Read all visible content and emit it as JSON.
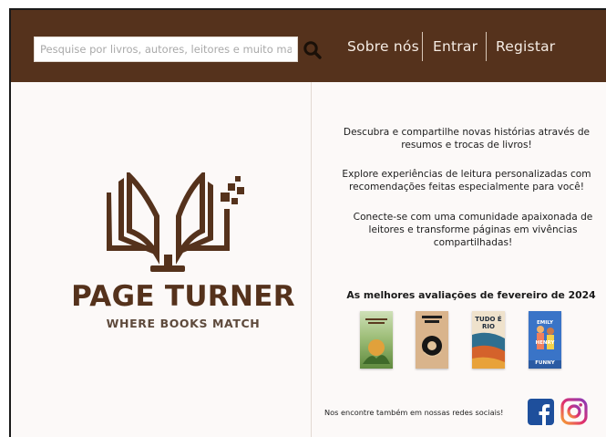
{
  "header": {
    "search_placeholder": "Pesquise por livros, autores, leitores e muito mais...",
    "search_icon": "magnifier-icon",
    "nav": {
      "about": "Sobre nós",
      "login": "Entrar",
      "register": "Registar"
    },
    "colors": {
      "bar": "#55321c",
      "nav_text": "#f5ece4"
    }
  },
  "brand": {
    "name": "PAGE TURNER",
    "tagline": "WHERE BOOKS MATCH",
    "logo_icon": "open-book-icon",
    "color": "#55321c"
  },
  "intro": {
    "blurbs": [
      "Descubra e compartilhe novas histórias através de resumos e trocas de livros!",
      "Explore experiências de leitura personalizadas com recomendações feitas especialmente para você!",
      "Conecte-se com uma comunidade apaixonada de leitores e transforme páginas em vivências compartilhadas!"
    ]
  },
  "best_reviews": {
    "title": "As melhores avaliações de fevereiro de 2024",
    "books": [
      {
        "cover_text": ""
      },
      {
        "cover_text": ""
      },
      {
        "cover_text": "TUDO É RIO"
      },
      {
        "cover_text": "EMILY HENRY FUNNY STORY"
      }
    ]
  },
  "social": {
    "text": "Nos encontre também em nossas redes sociais!",
    "facebook_color": "#1e4f9c",
    "instagram_color": "#c2367a"
  }
}
